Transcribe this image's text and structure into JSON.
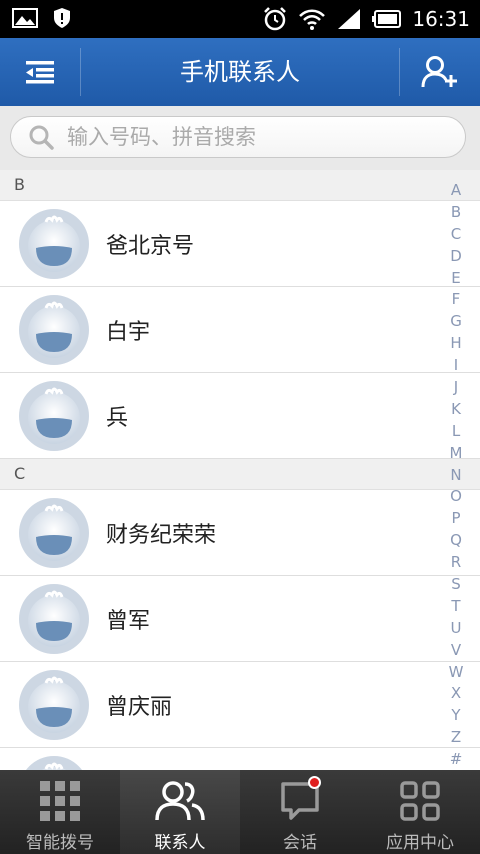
{
  "status": {
    "time": "16:31"
  },
  "header": {
    "title": "手机联系人"
  },
  "search": {
    "placeholder": "输入号码、拼音搜索"
  },
  "sections": [
    {
      "letter": "B",
      "contacts": [
        "爸北京号",
        "白宇",
        "兵"
      ]
    },
    {
      "letter": "C",
      "contacts": [
        "财务纪荣荣",
        "曾军",
        "曾庆丽"
      ]
    }
  ],
  "index": [
    "A",
    "B",
    "C",
    "D",
    "E",
    "F",
    "G",
    "H",
    "I",
    "J",
    "K",
    "L",
    "M",
    "N",
    "O",
    "P",
    "Q",
    "R",
    "S",
    "T",
    "U",
    "V",
    "W",
    "X",
    "Y",
    "Z",
    "#"
  ],
  "tabs": [
    {
      "label": "智能拨号",
      "icon": "dialpad-icon"
    },
    {
      "label": "联系人",
      "icon": "contacts-icon",
      "active": true
    },
    {
      "label": "会话",
      "icon": "chat-bubble-icon",
      "badge": true
    },
    {
      "label": "应用中心",
      "icon": "apps-grid-icon"
    }
  ],
  "colors": {
    "appbar": "#2465b2",
    "tabbar": "#2a2a2a",
    "badge": "#e02020",
    "index": "#8a98b4"
  }
}
